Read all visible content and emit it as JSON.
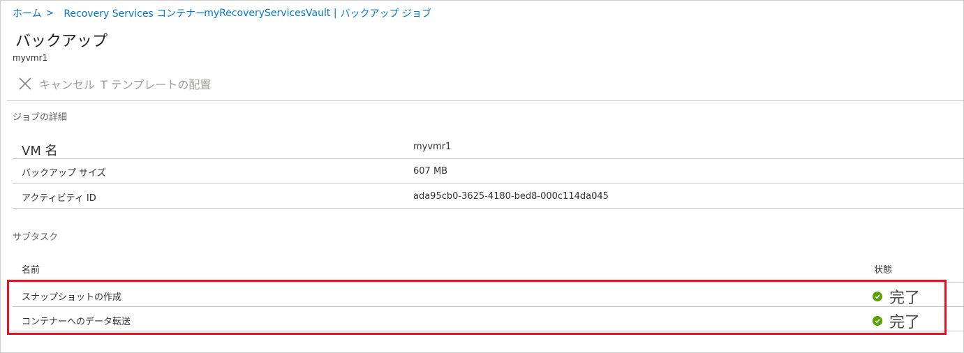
{
  "breadcrumb": {
    "home": "ホーム",
    "separator": ">",
    "recovery_services": "Recovery Services コンテナー",
    "vault": "myRecoveryServicesVault |",
    "jobs": "バックアップ ジョブ"
  },
  "page": {
    "title": "バックアップ",
    "subtitle": "myvmr1"
  },
  "toolbar": {
    "cancel_label": "キャンセル",
    "deploy_template_label": "T テンプレートの配置"
  },
  "job_details": {
    "section_label": "ジョブの詳細",
    "rows": [
      {
        "key": "VM 名",
        "value": "myvmr1"
      },
      {
        "key": "バックアップ サイズ",
        "value": "607 MB"
      },
      {
        "key": "アクティビティ ID",
        "value": "ada95cb0-3625-4180-bed8-000c114da045"
      }
    ]
  },
  "subtasks": {
    "section_label": "サブタスク",
    "columns": {
      "name": "名前",
      "status": "状態"
    },
    "rows": [
      {
        "name": "スナップショットの作成",
        "status": "完了"
      },
      {
        "name": "コンテナーへのデータ転送",
        "status": "完了"
      }
    ]
  },
  "colors": {
    "link": "#0078d4",
    "success": "#57a300",
    "highlight": "#e81123"
  },
  "icons": {
    "cancel": "close-icon",
    "status": "check-circle-icon"
  }
}
